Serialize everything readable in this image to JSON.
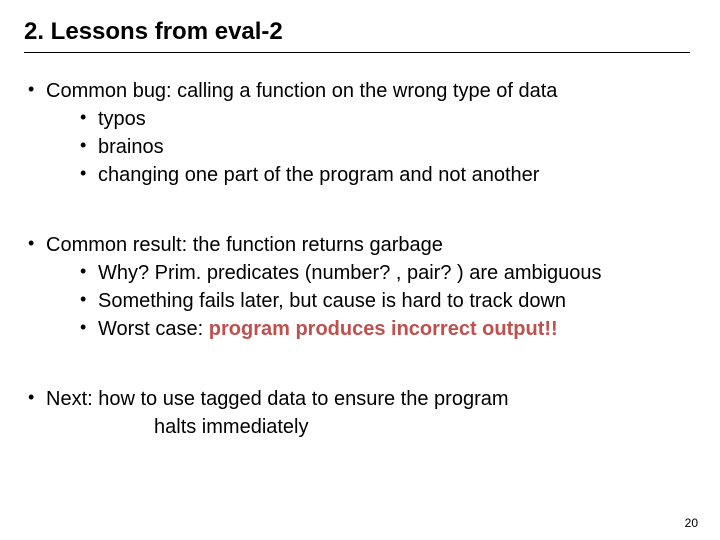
{
  "title": "2. Lessons from eval-2",
  "block1": {
    "lead": "Common bug: calling a function on the wrong type of data",
    "items": [
      "typos",
      "brainos",
      "changing one part of the program and not another"
    ]
  },
  "block2": {
    "lead": "Common result: the function returns garbage",
    "items": [
      "Why? Prim. predicates (number? , pair? ) are ambiguous",
      "Something fails later, but cause is hard to track down"
    ],
    "worst_prefix": "Worst case: ",
    "worst_emph": "program produces incorrect output!!"
  },
  "block3": {
    "lead": "Next: how to use tagged data to ensure the program",
    "cont": "halts immediately"
  },
  "page": "20"
}
